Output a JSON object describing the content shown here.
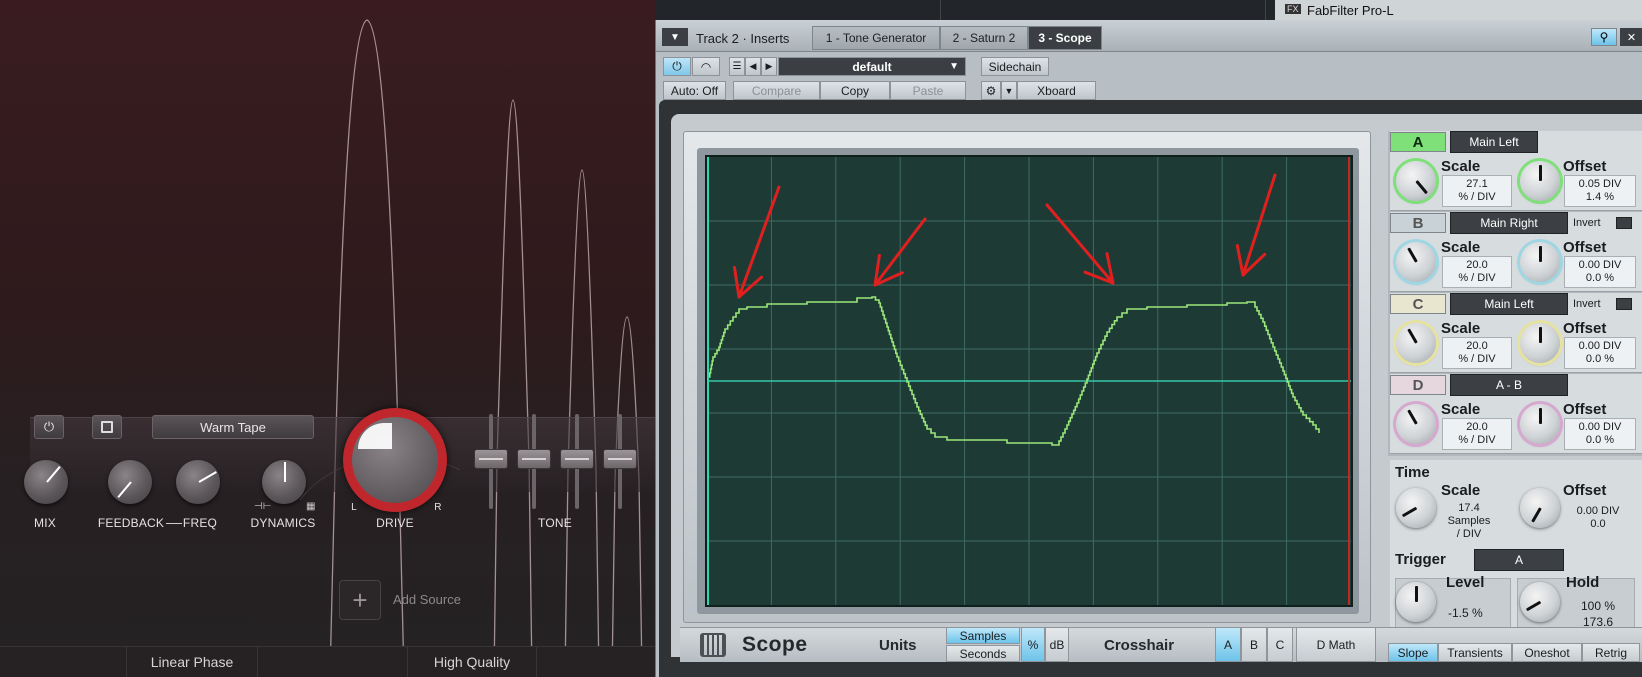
{
  "saturn": {
    "preset_name": "Warm Tape",
    "knobs": {
      "mix": "MIX",
      "feedback": "FEEDBACK",
      "freq": "FREQ",
      "dynamics": "DYNAMICS",
      "drive": "DRIVE",
      "tone": "TONE"
    },
    "drive_left": "L",
    "drive_right": "R",
    "add_source": "Add Source",
    "bottom_tabs": [
      "Linear Phase",
      "High Quality"
    ],
    "accent_color": "#c0272d"
  },
  "daw": {
    "fx_label": "FX",
    "fx_plugin": "FabFilter Pro-L"
  },
  "plugin_window": {
    "title": "Track 2 · Inserts",
    "tabs": [
      "1 - Tone Generator",
      "2 - Saturn 2",
      "3 - Scope"
    ],
    "preset": "default",
    "auto": "Auto: Off",
    "compare": "Compare",
    "copy": "Copy",
    "paste": "Paste",
    "sidechain": "Sidechain",
    "xboard": "Xboard"
  },
  "scope": {
    "name": "Scope",
    "units_label": "Units",
    "units_options": [
      "Samples",
      "Seconds"
    ],
    "percent": "%",
    "db": "dB",
    "crosshair_label": "Crosshair",
    "crosshair_options": [
      "A",
      "B",
      "C"
    ],
    "dmath": "D Math",
    "trace_color": "#9be67a",
    "grid_color": "#3f6b62",
    "arrow_color": "#e0201f"
  },
  "channels": [
    {
      "letter": "A",
      "source": "Main Left",
      "invert": "",
      "scale_label": "Scale",
      "scale_value": "27.1",
      "scale_unit": "% / DIV",
      "offset_label": "Offset",
      "offset_value": "0.05 DIV",
      "offset_pct": "1.4 %",
      "color": "#7fe07a"
    },
    {
      "letter": "B",
      "source": "Main Right",
      "invert": "Invert",
      "scale_label": "Scale",
      "scale_value": "20.0",
      "scale_unit": "% / DIV",
      "offset_label": "Offset",
      "offset_value": "0.00 DIV",
      "offset_pct": "0.0 %",
      "color": "#9fd6e4"
    },
    {
      "letter": "C",
      "source": "Main Left",
      "invert": "Invert",
      "scale_label": "Scale",
      "scale_value": "20.0",
      "scale_unit": "% / DIV",
      "offset_label": "Offset",
      "offset_value": "0.00 DIV",
      "offset_pct": "0.0 %",
      "color": "#e6e2a0"
    },
    {
      "letter": "D",
      "source": "A - B",
      "invert": "",
      "scale_label": "Scale",
      "scale_value": "20.0",
      "scale_unit": "% / DIV",
      "offset_label": "Offset",
      "offset_value": "0.00 DIV",
      "offset_pct": "0.0 %",
      "color": "#d7a8cf"
    }
  ],
  "time": {
    "label": "Time",
    "scale_label": "Scale",
    "scale_value": "17.4",
    "scale_unit1": "Samples",
    "scale_unit2": "/ DIV",
    "offset_label": "Offset",
    "offset_value": "0.00 DIV",
    "offset_value2": "0.0"
  },
  "trigger": {
    "label": "Trigger",
    "source": "A",
    "level_label": "Level",
    "level_value": "-1.5 %",
    "hold_label": "Hold",
    "hold_value": "100 %",
    "hold_value2": "173.6",
    "modes": [
      "Slope",
      "Transients",
      "Oneshot",
      "Retrig"
    ]
  }
}
